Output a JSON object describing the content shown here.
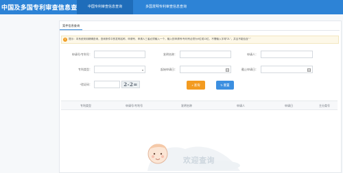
{
  "header": {
    "title": "中国及多国专利审查信息查询",
    "tabs": [
      {
        "label": "中国专利审查信息查询",
        "active": true
      },
      {
        "label": "多国发明专利审查信息查询",
        "active": false
      }
    ]
  },
  "panel": {
    "tab_label": "案件信息查询",
    "notice": "提示：本系统采用精确查询，查询条件中的发明名称、申请号、申请人三者必须输入一个，输入的申请号/专利号必须为9位或13位，不需输入字母\"ZL\"，并且不能包含\"·\""
  },
  "form": {
    "application_no": {
      "label": "申请号/专利号：",
      "value": ""
    },
    "invention_name": {
      "label": "发明名称：",
      "value": ""
    },
    "applicant": {
      "label": "申请人：",
      "value": ""
    },
    "patent_type": {
      "label": "专利类型：",
      "value": ""
    },
    "start_date": {
      "label": "起始申请日：",
      "value": ""
    },
    "end_date": {
      "label": "截止申请日：",
      "value": ""
    },
    "captcha": {
      "label": "*验证码：",
      "value": "",
      "image_text": "2-2="
    }
  },
  "buttons": {
    "search": "查询",
    "reset": "重置"
  },
  "table": {
    "columns": [
      "专利类型",
      "申请号/专利号",
      "发明名称",
      "申请人",
      "申请日",
      "主分类号"
    ]
  },
  "empty_state": {
    "text": "欢迎查询"
  },
  "colors": {
    "primary": "#2d83d6",
    "active_tab": "#1f6dba",
    "search_button": "#f39b20",
    "reset_button": "#3c8fe0",
    "notice_icon": "#f19b1d"
  }
}
